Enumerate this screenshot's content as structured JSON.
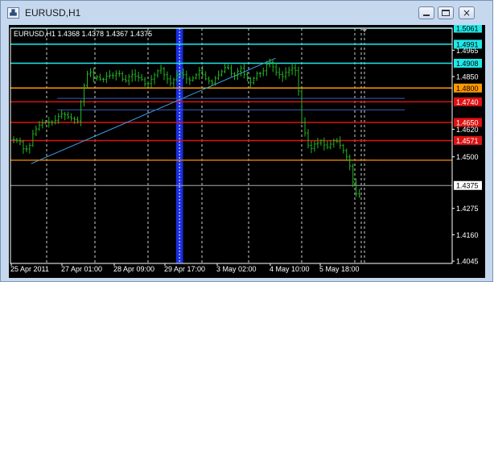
{
  "window": {
    "title": "EURUSD,H1",
    "icon_name": "chart-window-icon",
    "controls": [
      {
        "name": "minimize-button",
        "icon": "minimize-icon"
      },
      {
        "name": "maximize-button",
        "icon": "maximize-icon"
      },
      {
        "name": "close-button",
        "icon": "close-icon",
        "glyph": "×"
      }
    ]
  },
  "chart_data": {
    "type": "bar",
    "style": "ohlc",
    "title": "EURUSD,H1  1.4368 1.4378 1.4367 1.4375",
    "symbol": "EURUSD",
    "timeframe": "H1",
    "last_ohlc": {
      "open": 1.4368,
      "high": 1.4378,
      "low": 1.4367,
      "close": 1.4375
    },
    "ylim": [
      1.4035,
      1.5061
    ],
    "y_ticks": [
      1.4965,
      1.485,
      1.462,
      1.45,
      1.4275,
      1.416,
      1.4045
    ],
    "x_ticks": [
      "25 Apr 2011",
      "27 Apr 01:00",
      "28 Apr 09:00",
      "29 Apr 17:00",
      "3 May 02:00",
      "4 May 10:00",
      "5 May 18:00"
    ],
    "bar_count": 109,
    "price_path": [
      [
        0,
        1.4575
      ],
      [
        2,
        1.457
      ],
      [
        4,
        1.4565
      ],
      [
        6,
        1.4525
      ],
      [
        9,
        1.4545
      ],
      [
        11,
        1.46
      ],
      [
        14,
        1.4635
      ],
      [
        17,
        1.465
      ],
      [
        20,
        1.4652
      ],
      [
        22,
        1.465
      ],
      [
        24,
        1.466
      ],
      [
        26,
        1.468
      ],
      [
        28,
        1.469
      ],
      [
        30,
        1.468
      ],
      [
        32,
        1.467
      ],
      [
        34,
        1.4665
      ],
      [
        36,
        1.466
      ],
      [
        37,
        1.4655
      ],
      [
        38,
        1.472
      ],
      [
        40,
        1.48
      ],
      [
        42,
        1.486
      ],
      [
        44,
        1.487
      ],
      [
        46,
        1.484
      ],
      [
        48,
        1.485
      ],
      [
        50,
        1.4835
      ],
      [
        52,
        1.484
      ],
      [
        54,
        1.486
      ],
      [
        56,
        1.485
      ],
      [
        58,
        1.486
      ],
      [
        60,
        1.487
      ],
      [
        62,
        1.484
      ],
      [
        64,
        1.483
      ],
      [
        66,
        1.485
      ],
      [
        68,
        1.486
      ],
      [
        70,
        1.485
      ],
      [
        71,
        1.484
      ],
      [
        72,
        1.485
      ],
      [
        74,
        1.483
      ],
      [
        76,
        1.481
      ],
      [
        78,
        1.483
      ],
      [
        80,
        1.485
      ],
      [
        82,
        1.487
      ],
      [
        84,
        1.489
      ],
      [
        86,
        1.486
      ],
      [
        88,
        1.484
      ],
      [
        90,
        1.482
      ],
      [
        92,
        1.484
      ],
      [
        94,
        1.486
      ],
      [
        96,
        1.487
      ],
      [
        98,
        1.485
      ],
      [
        100,
        1.483
      ],
      [
        102,
        1.484
      ],
      [
        104,
        1.485
      ],
      [
        106,
        1.488
      ],
      [
        108,
        1.486
      ],
      [
        110,
        1.484
      ],
      [
        112,
        1.483
      ],
      [
        114,
        1.482
      ],
      [
        116,
        1.485
      ],
      [
        118,
        1.486
      ],
      [
        120,
        1.488
      ],
      [
        122,
        1.49
      ],
      [
        124,
        1.487
      ],
      [
        126,
        1.485
      ],
      [
        128,
        1.487
      ],
      [
        130,
        1.489
      ],
      [
        132,
        1.486
      ],
      [
        134,
        1.484
      ],
      [
        136,
        1.482
      ],
      [
        138,
        1.485
      ],
      [
        140,
        1.487
      ],
      [
        142,
        1.486
      ],
      [
        144,
        1.489
      ],
      [
        146,
        1.492
      ],
      [
        148,
        1.49
      ],
      [
        150,
        1.487
      ],
      [
        152,
        1.486
      ],
      [
        154,
        1.485
      ],
      [
        156,
        1.487
      ],
      [
        158,
        1.488
      ],
      [
        160,
        1.489
      ],
      [
        162,
        1.487
      ],
      [
        163,
        1.48
      ],
      [
        165,
        1.465
      ],
      [
        167,
        1.46
      ],
      [
        168,
        1.456
      ],
      [
        170,
        1.453
      ],
      [
        172,
        1.4555
      ],
      [
        174,
        1.456
      ],
      [
        176,
        1.457
      ],
      [
        178,
        1.455
      ],
      [
        180,
        1.454
      ],
      [
        182,
        1.456
      ],
      [
        184,
        1.4575
      ],
      [
        186,
        1.456
      ],
      [
        188,
        1.454
      ],
      [
        190,
        1.451
      ],
      [
        192,
        1.448
      ],
      [
        194,
        1.44
      ],
      [
        196,
        1.434
      ],
      [
        198,
        1.433
      ]
    ],
    "horizontal_levels": [
      {
        "price": 1.5061,
        "color": "#20e8e8",
        "label": "1.5061",
        "label_bg": "#20e8e8",
        "label_color": "#000000"
      },
      {
        "price": 1.4991,
        "color": "#20e8e8",
        "label": "1.4991",
        "label_bg": "#20e8e8",
        "label_color": "#000000"
      },
      {
        "price": 1.4908,
        "color": "#20e8e8",
        "label": "1.4908",
        "label_bg": "#20e8e8",
        "label_color": "#000000"
      },
      {
        "price": 1.48,
        "color": "#ff9900",
        "label": "1.4800",
        "label_bg": "#ff9900",
        "label_color": "#000000"
      },
      {
        "price": 1.474,
        "color": "#dd1111",
        "label": "1.4740",
        "label_bg": "#dd1111",
        "label_color": "#ffffff"
      },
      {
        "price": 1.465,
        "color": "#dd1111",
        "label": "1.4650",
        "label_bg": "#dd1111",
        "label_color": "#ffffff"
      },
      {
        "price": 1.4571,
        "color": "#dd1111",
        "label": "1.4571",
        "label_bg": "#dd1111",
        "label_color": "#ffffff"
      },
      {
        "price": 1.4485,
        "color": "#d07a00",
        "label": "",
        "label_bg": "",
        "label_color": ""
      },
      {
        "price": 1.4375,
        "color": "#a8a8a8",
        "label": "1.4375",
        "label_bg": "#ffffff",
        "label_color": "#000000"
      }
    ],
    "segments": [
      {
        "x1": 10,
        "y1": 1.447,
        "x2": 150,
        "y2": 1.493,
        "color": "#3aa0e8"
      },
      {
        "x1": 10,
        "y1": 1.4485,
        "x2": 210,
        "y2": 1.4485,
        "color": "#d07a00"
      },
      {
        "x1": 25,
        "y1": 1.4755,
        "x2": 224,
        "y2": 1.4755,
        "color": "#3a5cc0"
      },
      {
        "x1": 25,
        "y1": 1.4705,
        "x2": 224,
        "y2": 1.4705,
        "color": "#3a5cc0"
      }
    ],
    "highlight_band": {
      "x_start": 93,
      "x_end": 97,
      "color": "#1a2ee0"
    },
    "grid": true,
    "background": "#000000",
    "bar_color": "#22b822",
    "text_color": "#ffffff"
  }
}
